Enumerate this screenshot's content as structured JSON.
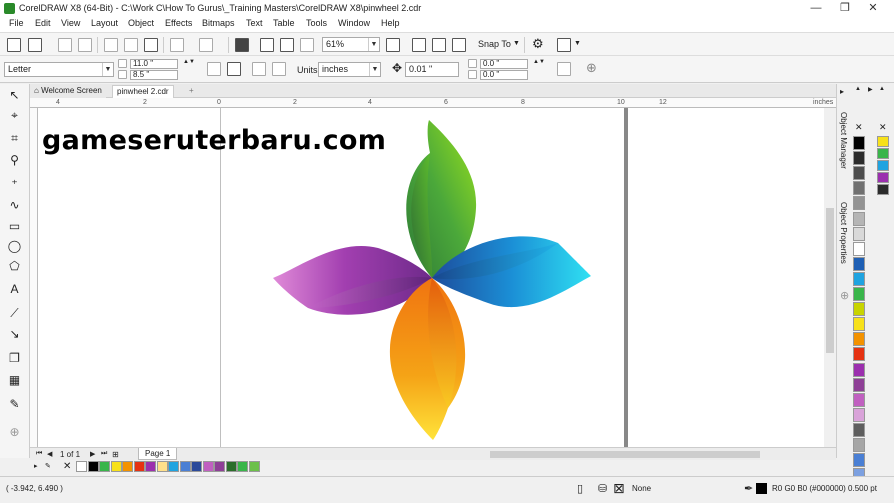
{
  "window": {
    "title": "CorelDRAW X8 (64-Bit) - C:\\Work C\\How To Gurus\\_Training Masters\\CorelDRAW X8\\pinwheel 2.cdr",
    "minimize": "—",
    "restore": "❐",
    "close": "✕"
  },
  "menu": [
    "File",
    "Edit",
    "View",
    "Layout",
    "Object",
    "Effects",
    "Bitmaps",
    "Text",
    "Table",
    "Tools",
    "Window",
    "Help"
  ],
  "standard_toolbar": {
    "zoom_value": "61%",
    "snap_to_label": "Snap To"
  },
  "property_bar": {
    "page_size": "Letter",
    "page_width": "11.0 \"",
    "page_height": "8.5 \"",
    "units_label": "Units:",
    "units_value": "inches",
    "nudge": "0.01 \"",
    "dup_x": "0.0 \"",
    "dup_y": "0.0 \""
  },
  "doc_tabs": {
    "welcome": "Welcome Screen",
    "file": "pinwheel 2.cdr",
    "add": "+"
  },
  "ruler": {
    "labels": [
      "4",
      "2",
      "0",
      "2",
      "4",
      "6",
      "8",
      "10",
      "12"
    ],
    "unit": "inches"
  },
  "canvas": {
    "watermark": "gameseruterbaru.com"
  },
  "page_nav": {
    "page_of": "1  of  1",
    "page_tab": "Page 1"
  },
  "dockers": {
    "object_manager": "Object Manager",
    "object_properties": "Object Properties"
  },
  "palette_colors": {
    "vertical_left": [
      "#000000",
      "#2b2b2b",
      "#4d4d4d",
      "#707070",
      "#939393",
      "#b5b5b5",
      "#d9d9d9",
      "#ffffff",
      "#1e5fb4",
      "#1fa3e0",
      "#39b54a",
      "#c8d400",
      "#f7e11a",
      "#f39200",
      "#e53212",
      "#9b2fae",
      "#8e3f96",
      "#c060c0",
      "#d9a3d9",
      "#5e5e5e",
      "#a6a6a6",
      "#4a7fd4",
      "#7ca0e0",
      "#2c4a9a"
    ],
    "vertical_right": [
      "#f7e11a",
      "#39b54a",
      "#1fa3e0",
      "#9b2fae",
      "#2b2b2b"
    ],
    "horizontal": [
      "#ffffff",
      "#000000",
      "#39b54a",
      "#f7e11a",
      "#f39200",
      "#e53212",
      "#9b2fae",
      "#ffe08a",
      "#1fa3e0",
      "#4a7fd4",
      "#2c4a9a",
      "#c060c0",
      "#8e3f96",
      "#2b6e2b",
      "#39b54a",
      "#6cc04a"
    ]
  },
  "status": {
    "coords": "( -3.942, 6.490 )",
    "fill_none": "None",
    "color_info": "R0 G0 B0 (#000000)  0.500 pt"
  }
}
